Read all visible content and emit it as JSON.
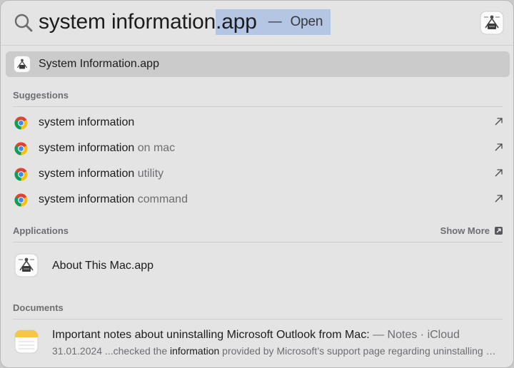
{
  "search": {
    "typed": "system information",
    "completion": ".app",
    "separator": "—",
    "action": "Open"
  },
  "top_hit": {
    "label": "System Information.app"
  },
  "sections": {
    "suggestions": "Suggestions",
    "applications": "Applications",
    "documents": "Documents",
    "show_more": "Show More"
  },
  "suggestions": [
    {
      "query": "system information",
      "rest": ""
    },
    {
      "query": "system information",
      "rest": " on mac"
    },
    {
      "query": "system information",
      "rest": " utility"
    },
    {
      "query": "system information",
      "rest": " command"
    }
  ],
  "applications": [
    {
      "label": "About This Mac.app"
    }
  ],
  "documents": [
    {
      "title": "Important notes about uninstalling Microsoft Outlook from Mac:",
      "meta": " — Notes · iCloud",
      "snippet_pre": "31.01.2024 ...checked the ",
      "snippet_highlight": "information",
      "snippet_post": " provided by Microsoft’s support page regarding uninstalling Microsoft Outlook from Mac"
    }
  ],
  "icons": {
    "search": "magnifying-glass",
    "suggestion": "chrome-browser",
    "suggestion_action": "arrow-up-right",
    "app": "system-information",
    "document": "notes",
    "show_more": "arrow-box"
  },
  "colors": {
    "selection_highlight": "#b4c6e3",
    "panel_background": "#e4e4e4",
    "selected_row": "#cbcbcb",
    "secondary_text": "#6e6e73"
  }
}
